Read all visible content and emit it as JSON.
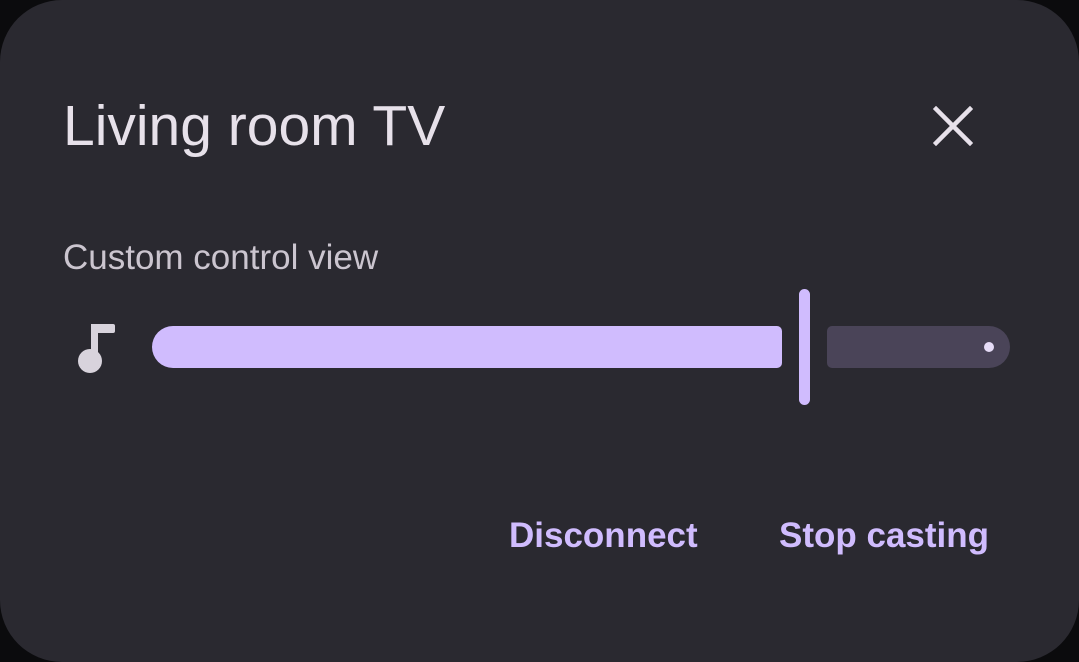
{
  "dialog": {
    "title": "Living room TV",
    "subtitle": "Custom control view",
    "volume": {
      "icon": "music-note-icon",
      "value_fraction": 0.76
    },
    "actions": {
      "disconnect_label": "Disconnect",
      "stop_casting_label": "Stop casting"
    },
    "close_icon": "close-icon"
  },
  "colors": {
    "surface": "#2a2930",
    "title_text": "#e7e1ea",
    "subtitle_text": "#cbc5cf",
    "accent": "#d0bcfe",
    "track_inactive": "#4a4458",
    "icon": "#d8d3dc"
  }
}
